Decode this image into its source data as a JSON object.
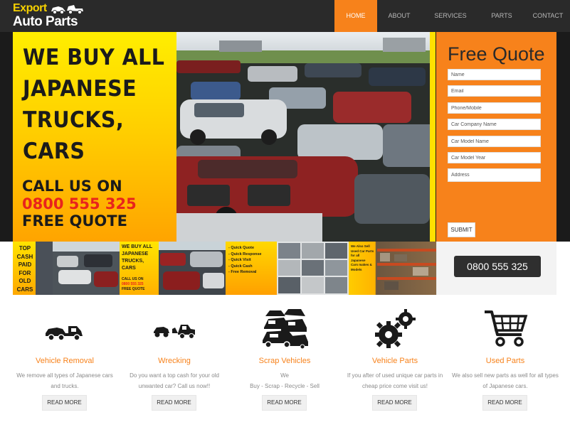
{
  "logo": {
    "line1": "Export",
    "line2": "Auto Parts"
  },
  "nav": [
    {
      "label": "HOME",
      "active": true
    },
    {
      "label": "ABOUT",
      "active": false
    },
    {
      "label": "SERVICES",
      "active": false
    },
    {
      "label": "PARTS",
      "active": false
    },
    {
      "label": "CONTACT",
      "active": false
    }
  ],
  "banner": {
    "headline": [
      "WE BUY ALL",
      "JAPANESE",
      "TRUCKS,",
      "CARS"
    ],
    "call_label": "CALL US ON",
    "phone": "0800 555 325",
    "free_quote": "FREE QUOTE"
  },
  "quote_form": {
    "title": "Free Quote",
    "fields": {
      "name": "Name",
      "email": "Email",
      "phone": "Phone/Mobile",
      "company": "Car Company Name",
      "model": "Car Model Name",
      "year": "Car Model Year",
      "address": "Address"
    },
    "submit": "SUBMIT"
  },
  "strip": {
    "tile1": [
      "TOP",
      "CASH",
      "PAID",
      "FOR",
      "OLD",
      "CARS"
    ],
    "tile3": {
      "headline": [
        "WE BUY ALL",
        "JAPANESE",
        "TRUCKS,",
        "CARS"
      ],
      "call": "CALL US ON",
      "phone": "0800 555 325",
      "free": "FREE QUOTE"
    },
    "tile5": [
      "- Quick Quote",
      "- Quick Response",
      "- Quick Visit",
      "- Quick Cash",
      "- Free Removal"
    ],
    "tile7": [
      "We Also Sell",
      "Used Car Parts",
      "for all Japanese",
      "Cars makes & Models"
    ]
  },
  "phone_button": "0800 555 325",
  "services": [
    {
      "title": "Vehicle Removal",
      "desc": "We remove all types of Japanese cars and trucks.",
      "button": "READ MORE",
      "icon": "tow-truck-icon"
    },
    {
      "title": "Wrecking",
      "desc": "Do you want a top cash for your old unwanted car? Call us now!!",
      "button": "READ MORE",
      "icon": "wrecking-icon"
    },
    {
      "title": "Scrap Vehicles",
      "desc_line1": "We",
      "desc_line2": "Buy - Scrap - Recycle - Sell",
      "button": "READ MORE",
      "icon": "scrap-cars-icon"
    },
    {
      "title": "Vehicle Parts",
      "desc": "If you after of used unique car parts in cheap price come visit us!",
      "button": "READ MORE",
      "icon": "gears-icon"
    },
    {
      "title": "Used Parts",
      "desc": "We also sell new parts as well for all types of Japanese cars.",
      "button": "READ MORE",
      "icon": "cart-icon"
    }
  ],
  "colors": {
    "accent": "#f7821b",
    "nav_bg": "#2a2a2a",
    "yellow": "#ffd000",
    "red_phone": "#e8241c"
  }
}
